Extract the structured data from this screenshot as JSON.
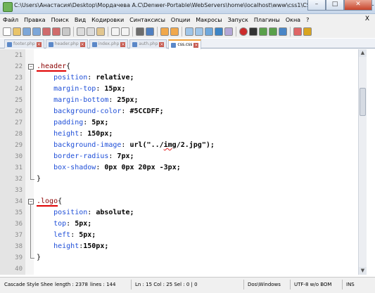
{
  "window": {
    "title": "C:\\Users\\Анастасия\\Desktop\\Мордачева А.С\\Denwer-Portable\\WebServers\\home\\localhost\\www\\css1\\CSS\\css.css - Notepad++"
  },
  "menu": {
    "items": [
      "Файл",
      "Правка",
      "Поиск",
      "Вид",
      "Кодировки",
      "Синтаксисы",
      "Опции",
      "Макросы",
      "Запуск",
      "Плагины",
      "Окна",
      "?"
    ],
    "close": "X"
  },
  "tabs": [
    {
      "label": "footer.php",
      "active": false
    },
    {
      "label": "header.php",
      "active": false
    },
    {
      "label": "index.php",
      "active": false
    },
    {
      "label": "auth.php",
      "active": false
    },
    {
      "label": "css.css",
      "active": true
    }
  ],
  "editor": {
    "lines": [
      {
        "n": "21",
        "text": ""
      },
      {
        "n": "22",
        "selector": ".header",
        "brace": "{"
      },
      {
        "n": "23",
        "prop": "position",
        "val": "relative;"
      },
      {
        "n": "24",
        "prop": "margin-top",
        "val": "15px;"
      },
      {
        "n": "25",
        "prop": "margin-bottom",
        "val": "25px;"
      },
      {
        "n": "26",
        "prop": "background-color",
        "val": "#5CCDFF;"
      },
      {
        "n": "27",
        "prop": "padding",
        "val": "5px;"
      },
      {
        "n": "28",
        "prop": "height",
        "val": "150px;"
      },
      {
        "n": "29",
        "prop": "background-image",
        "val_pre": "url(\"../",
        "val_squig": "img",
        "val_post": "/2.jpg\");"
      },
      {
        "n": "30",
        "prop": "border-radius",
        "val": "7px;"
      },
      {
        "n": "31",
        "prop": "box-shadow",
        "val": "0px 0px 20px -3px;"
      },
      {
        "n": "32",
        "close": "}"
      },
      {
        "n": "33",
        "text": ""
      },
      {
        "n": "34",
        "selector": ".logo",
        "brace": "{"
      },
      {
        "n": "35",
        "prop": "position",
        "val": "absolute;"
      },
      {
        "n": "36",
        "prop": "top",
        "val": "5px;"
      },
      {
        "n": "37",
        "prop": "left",
        "val": "5px;"
      },
      {
        "n": "38",
        "prop": "height",
        "val": "150px;",
        "nospace": true
      },
      {
        "n": "39",
        "close": "}"
      },
      {
        "n": "40",
        "text": ""
      }
    ]
  },
  "status": {
    "filetype": "Cascade Style Shee",
    "length": "length : 2378",
    "lines": "lines : 144",
    "position": "Ln : 15   Col : 25   Sel : 0 | 0",
    "eol": "Dos\\Windows",
    "encoding": "UTF-8 w/o BOM",
    "mode": "INS"
  }
}
